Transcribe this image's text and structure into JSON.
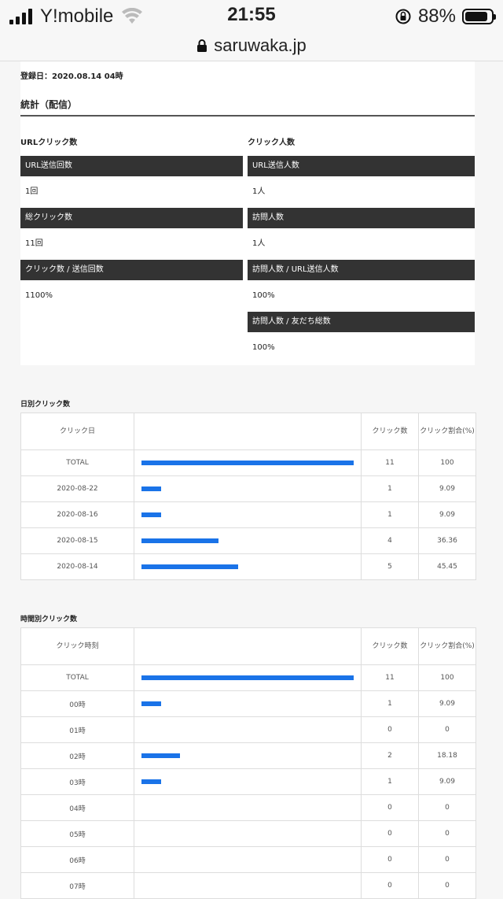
{
  "status_bar": {
    "carrier": "Y!mobile",
    "time": "21:55",
    "battery": "88%",
    "battery_level": 0.88
  },
  "url_bar": {
    "domain": "saruwaka.jp"
  },
  "page": {
    "registered": "登録日：2020.08.14 04時",
    "section_title": "統計（配信）",
    "url_clicks": {
      "title": "URLクリック数",
      "rows": [
        {
          "label": "URL送信回数",
          "value": "1回"
        },
        {
          "label": "総クリック数",
          "value": "11回"
        },
        {
          "label": "クリック数 / 送信回数",
          "value": "1100%"
        }
      ]
    },
    "click_people": {
      "title": "クリック人数",
      "rows": [
        {
          "label": "URL送信人数",
          "value": "1人"
        },
        {
          "label": "訪問人数",
          "value": "1人"
        },
        {
          "label": "訪問人数 / URL送信人数",
          "value": "100%"
        },
        {
          "label": "訪問人数 / 友だち総数",
          "value": "100%"
        }
      ]
    }
  },
  "daily_table": {
    "title": "日別クリック数",
    "headers": [
      "クリック日",
      "",
      "クリック数",
      "クリック割合(%)"
    ],
    "rows": [
      {
        "label": "TOTAL",
        "count": "11",
        "pct": "100",
        "ratio": 1.0
      },
      {
        "label": "2020-08-22",
        "count": "1",
        "pct": "9.09",
        "ratio": 0.0909
      },
      {
        "label": "2020-08-16",
        "count": "1",
        "pct": "9.09",
        "ratio": 0.0909
      },
      {
        "label": "2020-08-15",
        "count": "4",
        "pct": "36.36",
        "ratio": 0.3636
      },
      {
        "label": "2020-08-14",
        "count": "5",
        "pct": "45.45",
        "ratio": 0.4545
      }
    ]
  },
  "hourly_table": {
    "title": "時間別クリック数",
    "headers": [
      "クリック時刻",
      "",
      "クリック数",
      "クリック割合(%)"
    ],
    "rows": [
      {
        "label": "TOTAL",
        "count": "11",
        "pct": "100",
        "ratio": 1.0
      },
      {
        "label": "00時",
        "count": "1",
        "pct": "9.09",
        "ratio": 0.0909
      },
      {
        "label": "01時",
        "count": "0",
        "pct": "0",
        "ratio": 0
      },
      {
        "label": "02時",
        "count": "2",
        "pct": "18.18",
        "ratio": 0.1818
      },
      {
        "label": "03時",
        "count": "1",
        "pct": "9.09",
        "ratio": 0.0909
      },
      {
        "label": "04時",
        "count": "0",
        "pct": "0",
        "ratio": 0
      },
      {
        "label": "05時",
        "count": "0",
        "pct": "0",
        "ratio": 0
      },
      {
        "label": "06時",
        "count": "0",
        "pct": "0",
        "ratio": 0
      },
      {
        "label": "07時",
        "count": "0",
        "pct": "0",
        "ratio": 0
      }
    ]
  },
  "colors": {
    "bar": "#1a73e8",
    "header_bg": "#333333"
  }
}
